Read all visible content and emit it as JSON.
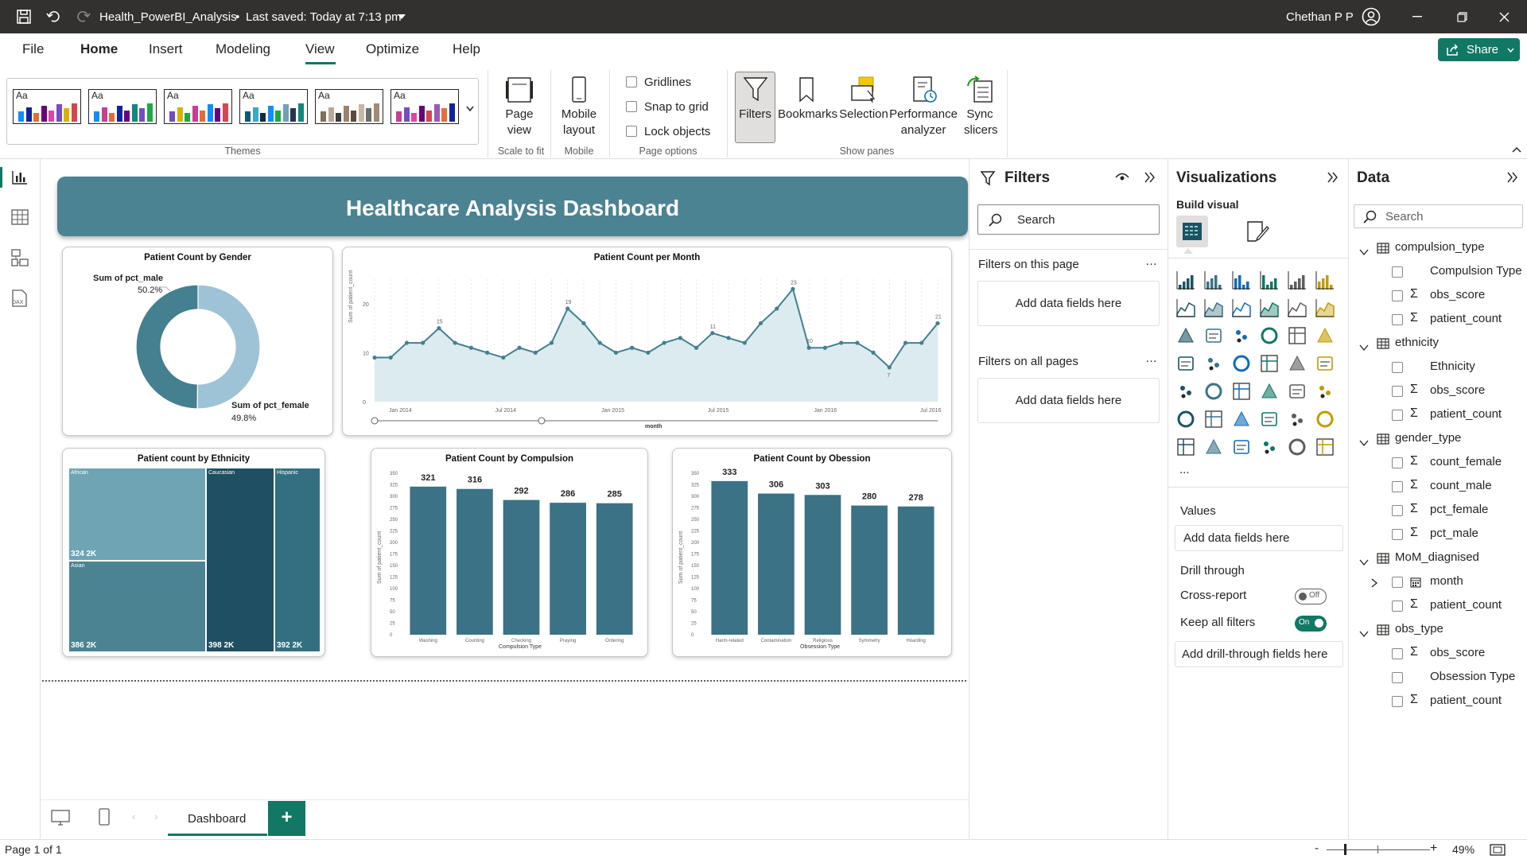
{
  "titlebar": {
    "file_name": "Health_PowerBI_Analysis",
    "saved_status": "Last saved: Today at 7:13 pm",
    "user": "Chethan P P"
  },
  "ribbon_tabs": [
    "File",
    "Home",
    "Insert",
    "Modeling",
    "View",
    "Optimize",
    "Help"
  ],
  "share_label": "Share",
  "themes": {
    "label": "Themes",
    "swatch_text": "Aa"
  },
  "scale": {
    "page_view": "Page view",
    "group": "Scale to fit"
  },
  "mobile": {
    "button": "Mobile layout",
    "group": "Mobile"
  },
  "page_options": {
    "gridlines": "Gridlines",
    "snap": "Snap to grid",
    "lock": "Lock objects",
    "group": "Page options"
  },
  "show_panes": {
    "filters": "Filters",
    "bookmarks": "Bookmarks",
    "selection": "Selection",
    "performance": "Performance analyzer",
    "sync": "Sync slicers",
    "group": "Show panes"
  },
  "dashboard": {
    "title": "Healthcare Analysis Dashboard"
  },
  "gender_chart": {
    "title": "Patient Count by Gender",
    "label_male": "Sum of pct_male",
    "value_male": "50.2%",
    "label_female": "Sum of pct_female",
    "value_female": "49.8%"
  },
  "month_chart": {
    "title": "Patient Count per Month",
    "xlabel": "month",
    "ylabel": "Sum of patient_count"
  },
  "ethnicity_chart": {
    "title": "Patient count by Ethnicity"
  },
  "compulsion_chart": {
    "title": "Patient Count by Compulsion",
    "xlabel": "Compulsion Type",
    "ylabel": "Sum of patient_count"
  },
  "obsession_chart": {
    "title": "Patient Count by Obession",
    "xlabel": "Obsession Type",
    "ylabel": "Sum of patient_count"
  },
  "chart_data": [
    {
      "type": "pie",
      "title": "Patient Count by Gender",
      "categories": [
        "Sum of pct_male",
        "Sum of pct_female"
      ],
      "values": [
        50.2,
        49.8
      ],
      "colors": [
        "#9ec3d6",
        "#44808f"
      ]
    },
    {
      "type": "area",
      "title": "Patient Count per Month",
      "xlabel": "month",
      "ylabel": "Sum of patient_count",
      "ylim": [
        0,
        25
      ],
      "yticks": [
        0,
        10,
        20
      ],
      "xticks": [
        "Jan 2014",
        "Jul 2014",
        "Jan 2015",
        "Jul 2015",
        "Jan 2016",
        "Jul 2016"
      ],
      "values": [
        9,
        9,
        12,
        12,
        15,
        12,
        11,
        10,
        9,
        11,
        10,
        12,
        19,
        16,
        12,
        10,
        11,
        10,
        12,
        13,
        11,
        14,
        13,
        12,
        16,
        19,
        23,
        11,
        11,
        12,
        12,
        10,
        7,
        12,
        12,
        16
      ],
      "point_labels": [
        {
          "index": 4,
          "text": "15"
        },
        {
          "index": 12,
          "text": "19"
        },
        {
          "index": 26,
          "text": "23"
        },
        {
          "index": 21,
          "text": "11"
        },
        {
          "index": 27,
          "text": "10"
        },
        {
          "index": 32,
          "text": "7"
        },
        {
          "index": 35,
          "text": "21"
        }
      ],
      "color": "#44808f"
    },
    {
      "type": "treemap",
      "title": "Patient count by Ethnicity",
      "items": [
        {
          "name": "African",
          "value": "324 2K"
        },
        {
          "name": "Asian",
          "value": "386 2K"
        },
        {
          "name": "Caucasian",
          "value": "398 2K"
        },
        {
          "name": "Hispanic",
          "value": "392 2K"
        }
      ]
    },
    {
      "type": "bar",
      "title": "Patient Count by Compulsion",
      "xlabel": "Compulsion Type",
      "ylabel": "Sum of patient_count",
      "ylim": [
        0,
        350
      ],
      "yticks": [
        0,
        25,
        50,
        75,
        100,
        125,
        150,
        175,
        200,
        225,
        250,
        275,
        300,
        325,
        350
      ],
      "categories": [
        "Washing",
        "Counting",
        "Checking",
        "Praying",
        "Ordering"
      ],
      "values": [
        321,
        316,
        292,
        286,
        285
      ],
      "color": "#3b7285"
    },
    {
      "type": "bar",
      "title": "Patient Count by Obession",
      "xlabel": "Obsession Type",
      "ylabel": "Sum of patient_count",
      "ylim": [
        0,
        350
      ],
      "yticks": [
        0,
        25,
        50,
        75,
        100,
        125,
        150,
        175,
        200,
        225,
        250,
        275,
        300,
        325,
        350
      ],
      "categories": [
        "Harm-related",
        "Contamination",
        "Religious",
        "Symmetry",
        "Hoarding"
      ],
      "values": [
        333,
        306,
        303,
        280,
        278
      ],
      "color": "#3b7285"
    }
  ],
  "filters": {
    "title": "Filters",
    "search": "Search",
    "this_page": "Filters on this page",
    "all_pages": "Filters on all pages",
    "add_fields": "Add data fields here"
  },
  "visualizations": {
    "title": "Visualizations",
    "build": "Build visual",
    "values": "Values",
    "add_fields": "Add data fields here",
    "drill": "Drill through",
    "cross": "Cross-report",
    "cross_state": "Off",
    "keep": "Keep all filters",
    "keep_state": "On",
    "add_drill": "Add drill-through fields here",
    "more": "..."
  },
  "data": {
    "title": "Data",
    "search": "Search",
    "tables": [
      {
        "name": "compulsion_type",
        "fields": [
          {
            "name": "Compulsion Type",
            "sigma": false
          },
          {
            "name": "obs_score",
            "sigma": true
          },
          {
            "name": "patient_count",
            "sigma": true
          }
        ]
      },
      {
        "name": "ethnicity",
        "fields": [
          {
            "name": "Ethnicity",
            "sigma": false
          },
          {
            "name": "obs_score",
            "sigma": true
          },
          {
            "name": "patient_count",
            "sigma": true
          }
        ]
      },
      {
        "name": "gender_type",
        "fields": [
          {
            "name": "count_female",
            "sigma": true
          },
          {
            "name": "count_male",
            "sigma": true
          },
          {
            "name": "pct_female",
            "sigma": true
          },
          {
            "name": "pct_male",
            "sigma": true
          }
        ]
      },
      {
        "name": "MoM_diagnised",
        "fields": [
          {
            "name": "month",
            "sigma": false,
            "calendar": true
          },
          {
            "name": "patient_count",
            "sigma": true
          }
        ]
      },
      {
        "name": "obs_type",
        "fields": [
          {
            "name": "obs_score",
            "sigma": true
          },
          {
            "name": "Obsession Type",
            "sigma": false
          },
          {
            "name": "patient_count",
            "sigma": true
          }
        ]
      }
    ]
  },
  "pagetabs": {
    "page": "Dashboard",
    "add": "+"
  },
  "status": {
    "page": "Page 1 of 1",
    "zoom": "49%"
  }
}
